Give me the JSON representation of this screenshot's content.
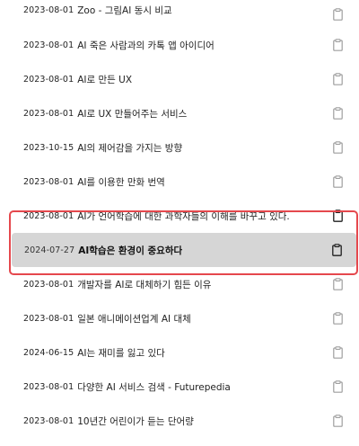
{
  "history": {
    "items": [
      {
        "date": "2023-08-01",
        "title": "Zoo - 그림AI 동시 비교"
      },
      {
        "date": "2023-08-01",
        "title": "AI 죽은 사람과의 카톡 앱 아이디어"
      },
      {
        "date": "2023-08-01",
        "title": "AI로 만든 UX"
      },
      {
        "date": "2023-08-01",
        "title": "AI로 UX 만들어주는 서비스"
      },
      {
        "date": "2023-10-15",
        "title": "AI의 제어감을 가지는 방향"
      },
      {
        "date": "2023-08-01",
        "title": "AI를 이용한 만화 번역"
      },
      {
        "date": "2023-08-01",
        "title": "AI가 언어학습에 대한 과학자들의 이해를 바꾸고 있다."
      },
      {
        "date": "2024-07-27",
        "title": "AI학습은 환경이 중요하다"
      },
      {
        "date": "2023-08-01",
        "title": "개발자를 AI로 대체하기 힘든 이유"
      },
      {
        "date": "2023-08-01",
        "title": "일본 애니메이션업계 AI 대체"
      },
      {
        "date": "2024-06-15",
        "title": "AI는 재미를 잃고 있다"
      },
      {
        "date": "2023-08-01",
        "title": "다양한 AI 서비스 검색 - Futurepedia"
      },
      {
        "date": "2023-08-01",
        "title": "10년간 어린이가 듣는 단어량"
      }
    ],
    "active_index": 7,
    "icon": "clipboard-icon",
    "colors": {
      "highlight_border": "#e5484d",
      "active_background": "#d6d6d6"
    }
  }
}
